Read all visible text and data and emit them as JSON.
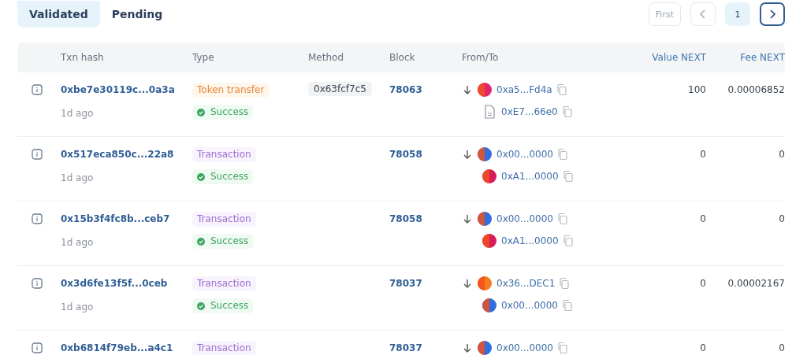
{
  "tabs": [
    {
      "label": "Validated",
      "selected": true
    },
    {
      "label": "Pending",
      "selected": false
    }
  ],
  "pagination": {
    "first": {
      "label": "First",
      "disabled": true
    },
    "prev_disabled": true,
    "page": "1",
    "next_disabled": false
  },
  "table": {
    "columns": [
      "Txn hash",
      "Type",
      "Method",
      "Block",
      "From/To",
      "Value NEXT",
      "Fee NEXT"
    ],
    "rows": [
      {
        "hash": "0xbe7e30119c...0a3a",
        "age": "1d ago",
        "type": {
          "label": "Token transfer",
          "kind": "token"
        },
        "status": "Success",
        "method": "0x63fcf7c5",
        "block": "78063",
        "from": {
          "address": "0xa5...Fd4a",
          "kind": "avatar",
          "color": "#e0246e"
        },
        "to": {
          "address": "0xE7...66e0",
          "kind": "contract"
        },
        "value": "100",
        "fee": "0.00006852"
      },
      {
        "hash": "0x517eca850c...22a8",
        "age": "1d ago",
        "type": {
          "label": "Transaction",
          "kind": "transaction"
        },
        "status": "Success",
        "block": "78058",
        "from": {
          "address": "0x00...0000",
          "kind": "avatar",
          "color": "#2f6fe0"
        },
        "to": {
          "address": "0xA1...0000",
          "kind": "avatar",
          "color": "#d81b5a"
        },
        "value": "0",
        "fee": "0"
      },
      {
        "hash": "0x15b3f4fc8b...ceb7",
        "age": "1d ago",
        "type": {
          "label": "Transaction",
          "kind": "transaction"
        },
        "status": "Success",
        "block": "78058",
        "from": {
          "address": "0x00...0000",
          "kind": "avatar",
          "color": "#2f6fe0"
        },
        "to": {
          "address": "0xA1...0000",
          "kind": "avatar",
          "color": "#d81b5a"
        },
        "value": "0",
        "fee": "0"
      },
      {
        "hash": "0x3d6fe13f5f...0ceb",
        "age": "1d ago",
        "type": {
          "label": "Transaction",
          "kind": "transaction"
        },
        "status": "Success",
        "block": "78037",
        "from": {
          "address": "0x36...DEC1",
          "kind": "avatar",
          "color": "#f57c1f"
        },
        "to": {
          "address": "0x00...0000",
          "kind": "avatar",
          "color": "#2f6fe0"
        },
        "value": "0",
        "fee": "0.00002167"
      },
      {
        "hash": "0xb6814f79eb...a4c1",
        "type": {
          "label": "Transaction",
          "kind": "transaction"
        },
        "block": "78037",
        "from": {
          "address": "0x00...0000",
          "kind": "avatar",
          "color": "#2f6fe0"
        },
        "value": "0",
        "fee": "0"
      }
    ]
  }
}
